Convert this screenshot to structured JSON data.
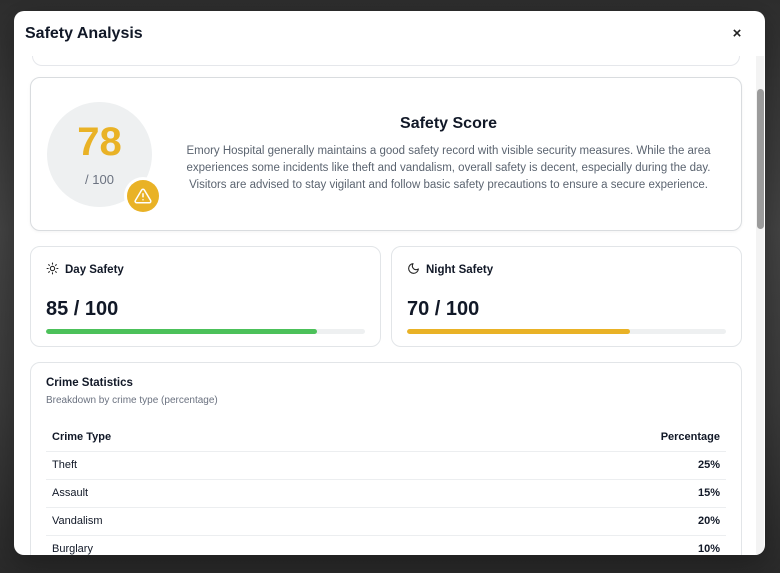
{
  "modal": {
    "title": "Safety Analysis",
    "close_label": "×"
  },
  "score": {
    "value": "78",
    "max": "/ 100",
    "heading": "Safety Score",
    "description": "Emory Hospital generally maintains a good safety record with visible security measures. While the area experiences some incidents like theft and vandalism, overall safety is decent, especially during the day. Visitors are advised to stay vigilant and follow basic safety precautions to ensure a secure experience.",
    "badge_icon": "warning-triangle-icon"
  },
  "day_safety": {
    "label": "Day Safety",
    "icon": "sun-icon",
    "value_text": "85 / 100",
    "fraction": 0.85,
    "color": "#4cc15a"
  },
  "night_safety": {
    "label": "Night Safety",
    "icon": "moon-icon",
    "value_text": "70 / 100",
    "fraction": 0.7,
    "color": "#e9b226"
  },
  "crime": {
    "title": "Crime Statistics",
    "subtitle": "Breakdown by crime type (percentage)",
    "headers": [
      "Crime Type",
      "Percentage"
    ],
    "rows": [
      {
        "type": "Theft",
        "pct": "25%"
      },
      {
        "type": "Assault",
        "pct": "15%"
      },
      {
        "type": "Vandalism",
        "pct": "20%"
      },
      {
        "type": "Burglary",
        "pct": "10%"
      }
    ]
  },
  "colors": {
    "accent": "#e9b226",
    "success": "#4cc15a"
  }
}
